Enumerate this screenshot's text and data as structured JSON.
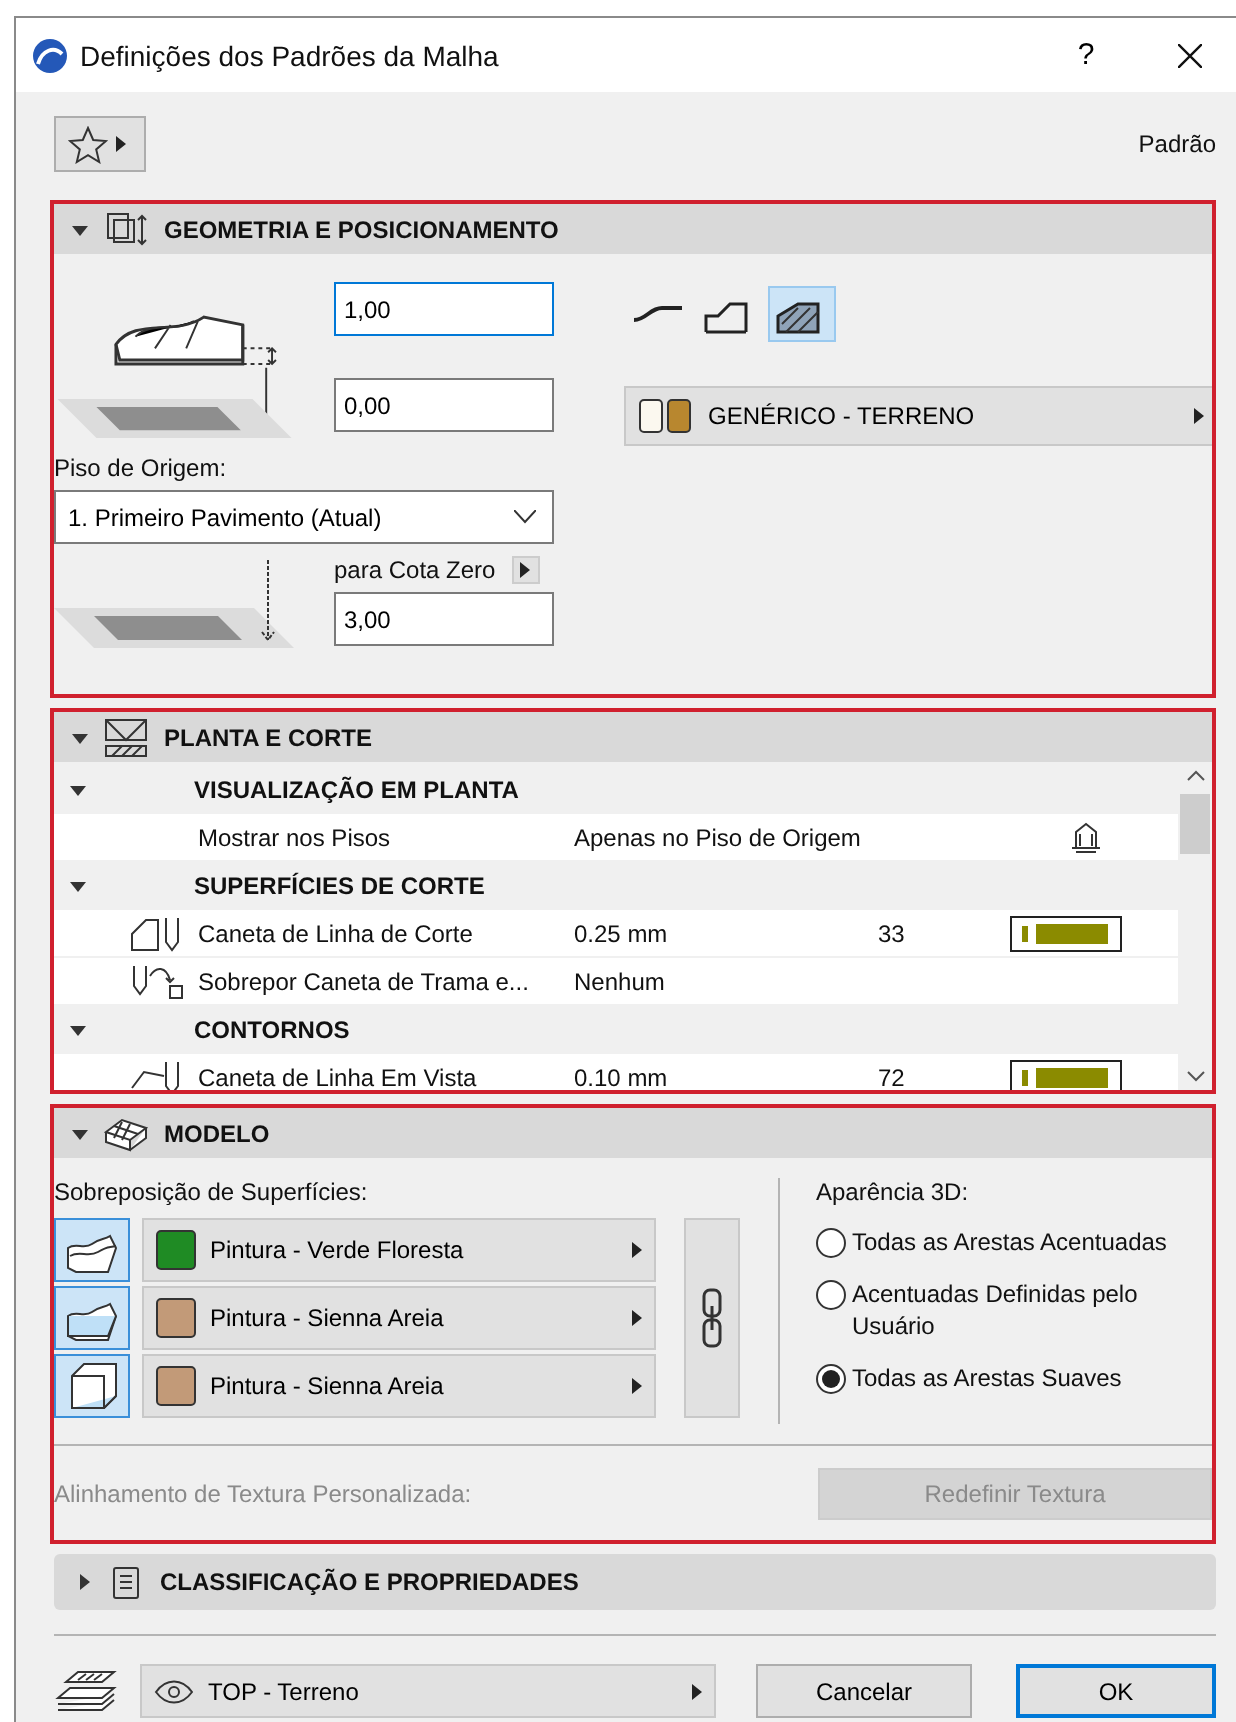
{
  "window": {
    "title": "Definições dos Padrões da Malha",
    "help": "?"
  },
  "favorites": {
    "label": "Padrão"
  },
  "geometry": {
    "title": "GEOMETRIA E POSICIONAMENTO",
    "expanded": true,
    "fields": [
      {
        "value": "1,00",
        "focused": true
      },
      {
        "value": "0,00",
        "focused": false
      }
    ],
    "home_story_label": "Piso de Origem:",
    "home_story": "1. Primeiro Pavimento (Atual)",
    "zero_label": "para Cota Zero",
    "zero_value": "3,00",
    "mesh_types": [
      {
        "kind": "ridges",
        "selected": false
      },
      {
        "kind": "user",
        "selected": false
      },
      {
        "kind": "solid",
        "selected": true
      }
    ],
    "material": "GENÉRICO - TERRENO"
  },
  "plan": {
    "title": "PLANTA E CORTE",
    "expanded": true,
    "rows": [
      {
        "kind": "group",
        "label": "VISUALIZAÇÃO EM PLANTA",
        "expanded": true
      },
      {
        "kind": "story",
        "label": "Mostrar nos Pisos",
        "value": "Apenas no Piso de Origem"
      },
      {
        "kind": "group",
        "label": "SUPERFÍCIES DE CORTE",
        "expanded": true
      },
      {
        "kind": "cutpen",
        "label": "Caneta de Linha de Corte",
        "value": "0.25 mm",
        "number": "33"
      },
      {
        "kind": "override",
        "label": "Sobrepor Caneta de Trama e...",
        "value": "Nenhum"
      },
      {
        "kind": "group",
        "label": "CONTORNOS",
        "expanded": true
      },
      {
        "kind": "viewpen",
        "label": "Caneta de Linha Em Vista",
        "value": "0.10 mm",
        "number": "72"
      }
    ]
  },
  "model": {
    "title": "MODELO",
    "expanded": true,
    "surfaces_label": "Sobreposição de Superfícies:",
    "surfaces": [
      {
        "kind": "top",
        "label": "Pintura - Verde Floresta",
        "color": "#1f8b24"
      },
      {
        "kind": "side",
        "label": "Pintura - Sienna Areia",
        "color": "#c29a78"
      },
      {
        "kind": "bottom",
        "label": "Pintura - Sienna Areia",
        "color": "#c29a78"
      }
    ],
    "appearance_label": "Aparência 3D:",
    "options": [
      {
        "label": "Todas as Arestas Acentuadas",
        "selected": false
      },
      {
        "label": "Acentuadas Definidas pelo Usuário",
        "selected": false
      },
      {
        "label": "Todas as Arestas Suaves",
        "selected": true
      }
    ],
    "texture_label": "Alinhamento de Textura Personalizada:",
    "texture_button": "Redefinir Textura",
    "texture_disabled": true
  },
  "classification": {
    "title": "CLASSIFICAÇÃO E PROPRIEDADES",
    "expanded": false
  },
  "footer": {
    "layer": "TOP - Terreno",
    "buttons": [
      {
        "label": "Cancelar",
        "default": false
      },
      {
        "label": "OK",
        "default": true
      }
    ]
  }
}
